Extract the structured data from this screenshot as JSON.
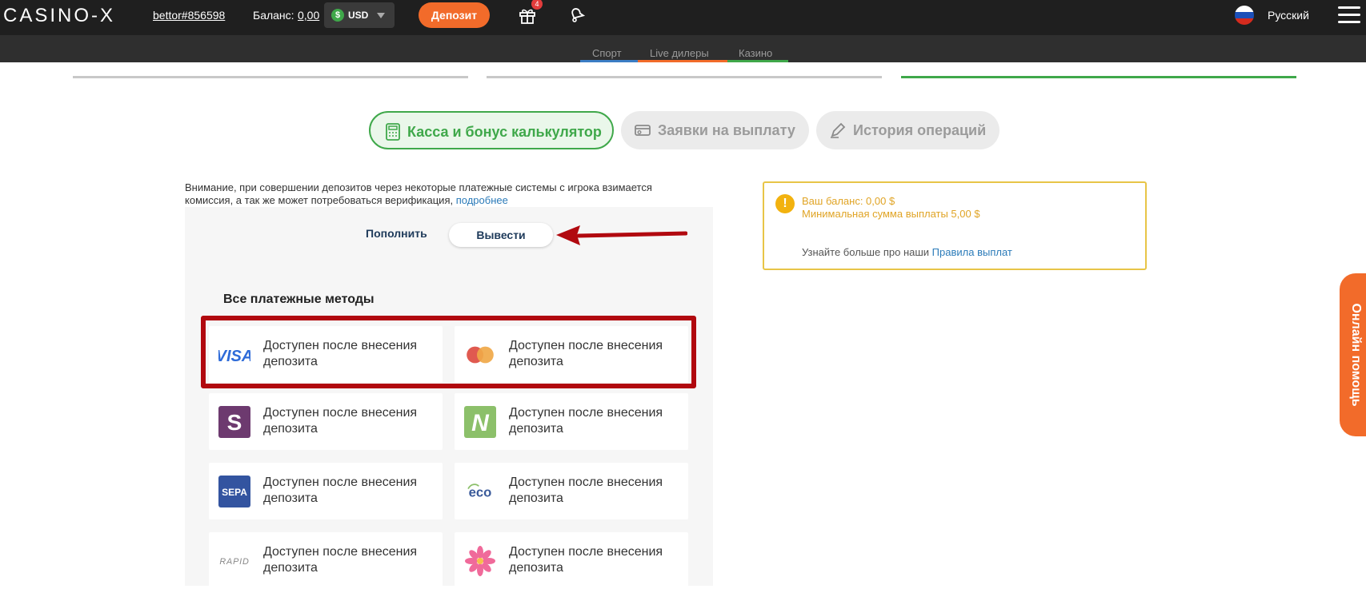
{
  "header": {
    "logo": "CASINO-X",
    "username": "bettor#856598",
    "balance_label": "Баланс:",
    "balance_value": "0,00",
    "currency_symbol": "$",
    "currency": "USD",
    "deposit_label": "Депозит",
    "gift_badge": "4",
    "language": "Русский"
  },
  "subnav": {
    "items": [
      "Спорт",
      "Live дилеры",
      "Казино"
    ],
    "colors": [
      "#3b7dc4",
      "#f26b2a",
      "#3fa84a"
    ]
  },
  "tabs": {
    "cashier": "Касса и бонус калькулятор",
    "withdraw_requests": "Заявки на выплату",
    "history": "История операций",
    "accent_color": "#3fa84a"
  },
  "notice": {
    "text": "Внимание, при совершении депозитов через некоторые платежные системы с игрока взимается комиссия, а так же может потребоваться верификация,",
    "link": "подробнее"
  },
  "switch": {
    "deposit": "Пополнить",
    "withdraw": "Вывести"
  },
  "methods": {
    "title": "Все платежные методы",
    "items": [
      {
        "icon": "visa-logo",
        "logo_text": "VISA",
        "text": "Доступен после внесения депозита"
      },
      {
        "icon": "mastercard-logo",
        "text": "Доступен после внесения депозита"
      },
      {
        "icon": "skrill-logo",
        "logo_text": "S",
        "text": "Доступен после внесения депозита"
      },
      {
        "icon": "neteller-logo",
        "logo_text": "N",
        "text": "Доступен после внесения депозита"
      },
      {
        "icon": "sepa-logo",
        "logo_text": "SEPA",
        "text": "Доступен после внесения депозита"
      },
      {
        "icon": "ecopayz-logo",
        "logo_text": "eco",
        "text": "Доступен после внесения депозита"
      },
      {
        "icon": "rapid-logo",
        "logo_text": "RAPID",
        "text": "Доступен после внесения депозита"
      },
      {
        "icon": "flower-logo",
        "text": "Доступен после внесения депозита"
      }
    ]
  },
  "info": {
    "balance": "Ваш баланс: 0,00 $",
    "min_withdraw": "Минимальная сумма выплаты 5,00 $",
    "more": "Узнайте больше про наши",
    "rules_link": "Правила выплат"
  },
  "help": {
    "label": "Онлайн помощь"
  }
}
